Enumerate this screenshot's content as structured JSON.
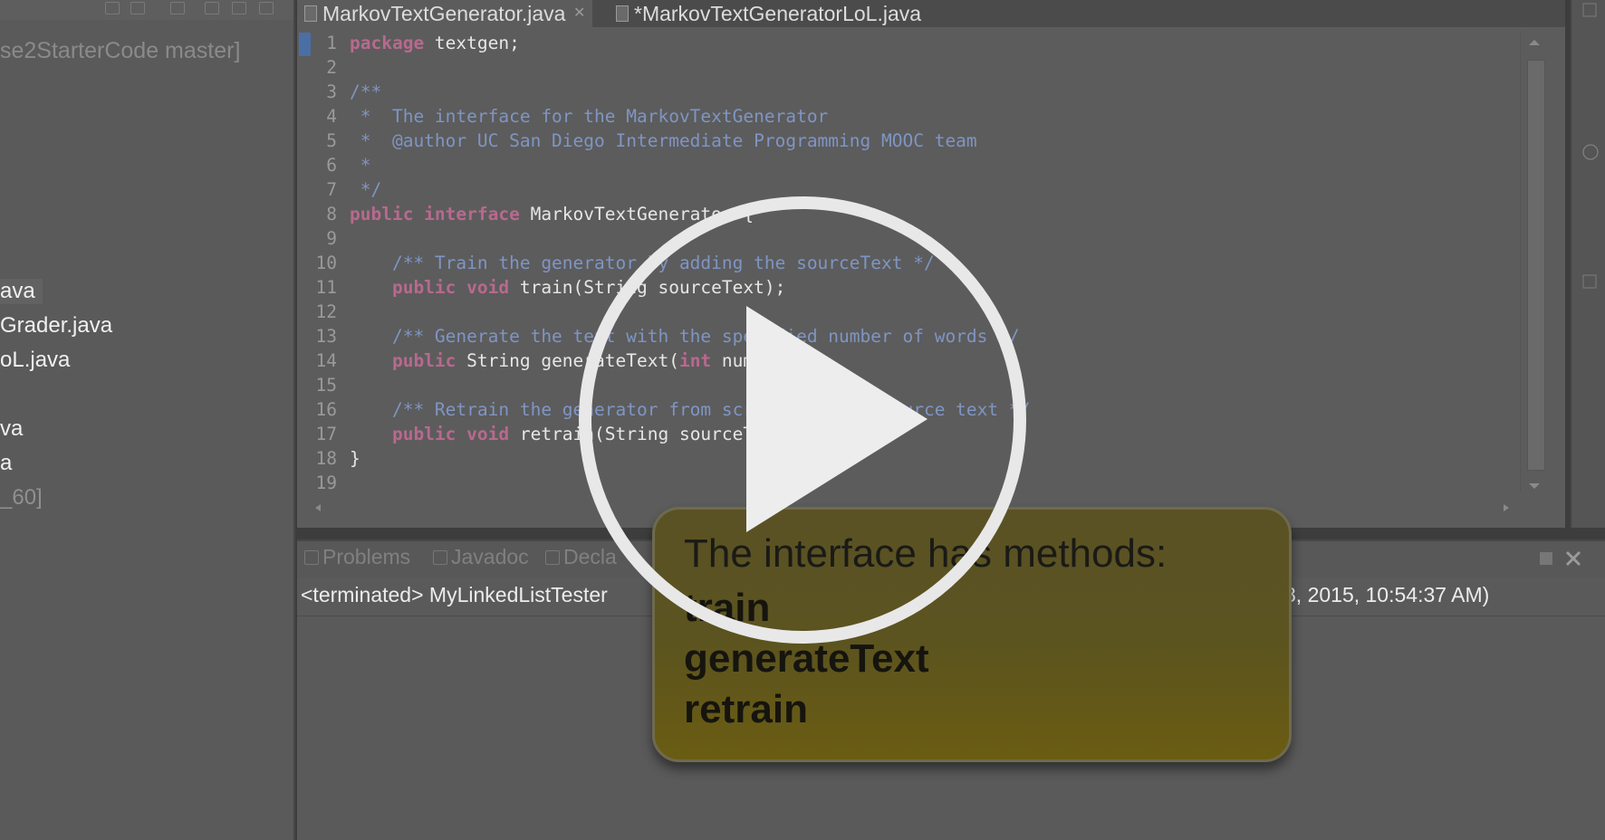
{
  "explorer": {
    "project_label": "se2StarterCode master]",
    "items": [
      {
        "label": "ava",
        "selected": true
      },
      {
        "label": "Grader.java"
      },
      {
        "label": "oL.java"
      },
      {
        "label": "va"
      },
      {
        "label": "a"
      },
      {
        "label": "_60]",
        "dim": true
      }
    ]
  },
  "editor": {
    "tabs": [
      {
        "label": "MarkovTextGenerator.java",
        "active": true,
        "close": "✕"
      },
      {
        "label": "*MarkovTextGeneratorLoL.java",
        "active": false
      }
    ],
    "line_numbers": [
      "1",
      "2",
      "3",
      "4",
      "5",
      "6",
      "7",
      "8",
      "9",
      "10",
      "11",
      "12",
      "13",
      "14",
      "15",
      "16",
      "17",
      "18",
      "19"
    ],
    "code": {
      "l1_kw": "package",
      "l1_rest": " textgen;",
      "l3": "/**",
      "l4": " *  The interface for the MarkovTextGenerator",
      "l5": " *  @author UC San Diego Intermediate Programming MOOC team",
      "l6": " *",
      "l7": " */",
      "l8_kw": "public interface",
      "l8_rest": " MarkovTextGenerator {",
      "l10": "    /** Train the generator by adding the sourceText */",
      "l11_kw": "    public void",
      "l11_rest": " train(String sourceText);",
      "l13": "    /** Generate the text with the specified number of words */",
      "l14_kw": "    public",
      "l14_mid": " String generateText(",
      "l14_kw2": "int",
      "l14_rest": " numWords);",
      "l16": "    /** Retrain the generator from scratch on the source text */",
      "l17_kw": "    public void",
      "l17_rest": " retrain(String sourceText);",
      "l18": "}"
    }
  },
  "bottom_panel": {
    "tabs": [
      "Problems",
      "Javadoc",
      "Decla"
    ],
    "console_left": "<terminated> MyLinkedListTester",
    "console_right": "8, 2015, 10:54:37 AM)"
  },
  "callout": {
    "title": "The interface has methods:",
    "items": [
      "train",
      "generateText",
      "retrain"
    ]
  },
  "overlay": {
    "icon": "play-icon"
  }
}
